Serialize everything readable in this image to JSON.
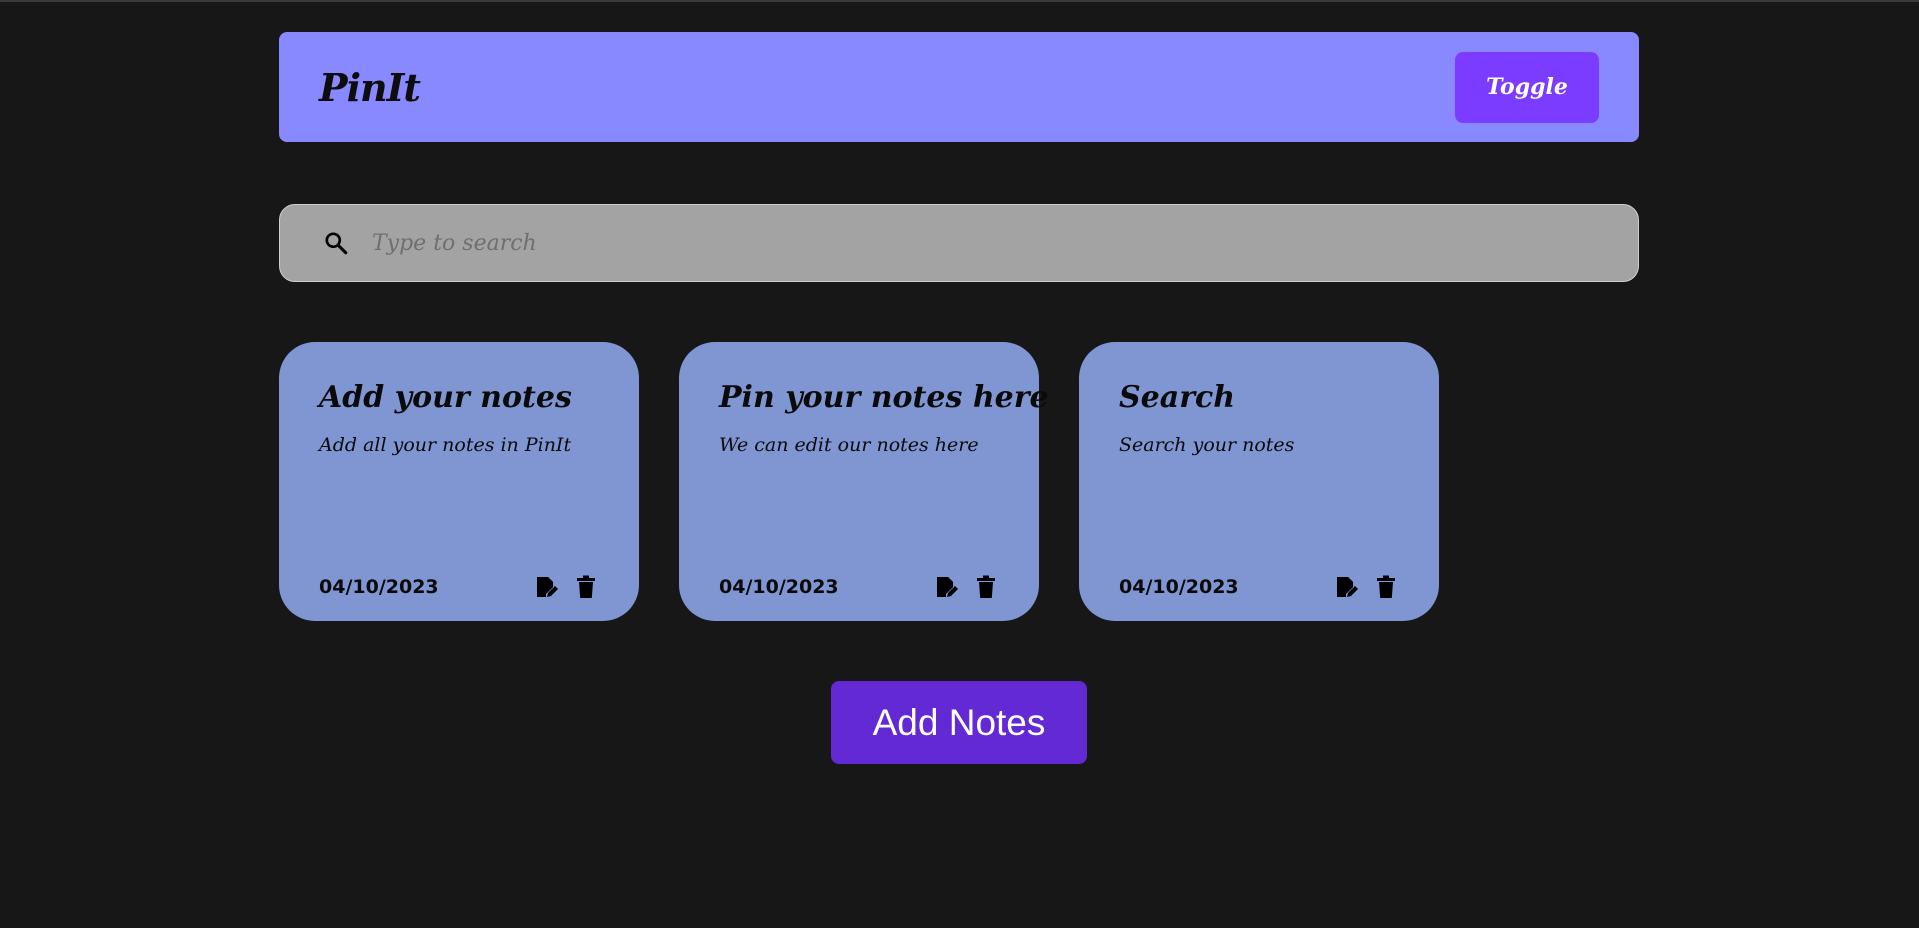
{
  "header": {
    "title": "PinIt",
    "toggle_label": "Toggle"
  },
  "search": {
    "placeholder": "Type to search",
    "value": "",
    "icon": "search-icon"
  },
  "notes": [
    {
      "title": "Add your notes",
      "body": "Add all your notes in PinIt",
      "date": "04/10/2023",
      "actions": [
        "edit-icon",
        "delete-icon"
      ]
    },
    {
      "title": "Pin your notes here",
      "body": "We can edit our notes here",
      "date": "04/10/2023",
      "actions": [
        "edit-icon",
        "delete-icon"
      ]
    },
    {
      "title": "Search",
      "body": "Search your notes",
      "date": "04/10/2023",
      "actions": [
        "edit-icon",
        "delete-icon"
      ]
    }
  ],
  "add_button_label": "Add Notes",
  "colors": {
    "background": "#171717",
    "header": "#8888ff",
    "toggle": "#7b3cff",
    "search": "#a3a3a3",
    "note": "#7f96d2",
    "add_button": "#6229d4"
  }
}
